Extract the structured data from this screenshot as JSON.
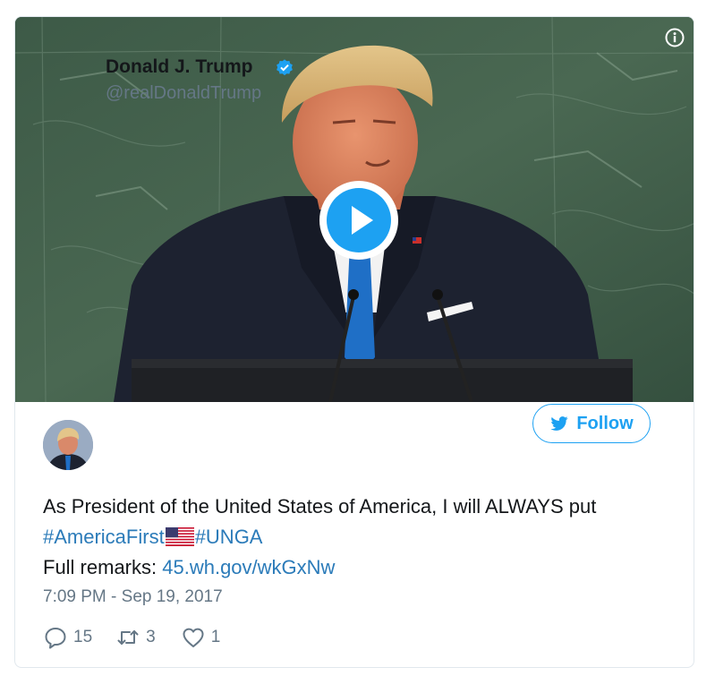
{
  "tweet": {
    "author": {
      "name": "Donald J. Trump",
      "handle": "@realDonaldTrump",
      "verified": true
    },
    "follow_label": "Follow",
    "text": {
      "line1": "As President of the United States of America, I will ALWAYS put",
      "hashtag_america_first": "#AmericaFirst",
      "flag_emoji": "🇺🇸",
      "hashtag_unga": "#UNGA",
      "full_remarks_label": "Full remarks: ",
      "link": "45.wh.gov/wkGxNw"
    },
    "timestamp": "7:09 PM - Sep 19, 2017",
    "stats": {
      "replies": "15",
      "retweets": "3",
      "likes": "1"
    }
  },
  "media": {
    "type": "video",
    "play_icon": "play-icon",
    "info_icon": "info-icon"
  },
  "colors": {
    "accent": "#1da1f2",
    "link": "#2b7bb9",
    "secondary_text": "#657786",
    "primary_text": "#14171a",
    "border": "#e1e8ed"
  }
}
